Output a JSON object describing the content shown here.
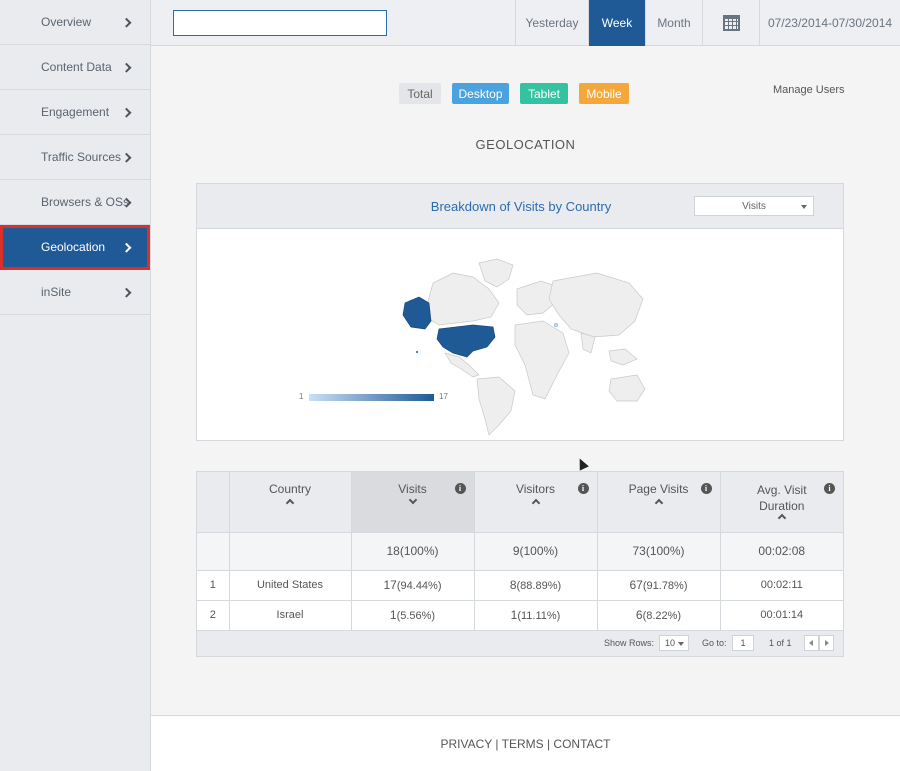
{
  "sidebar": {
    "items": [
      {
        "label": "Overview"
      },
      {
        "label": "Content Data"
      },
      {
        "label": "Engagement"
      },
      {
        "label": "Traffic Sources"
      },
      {
        "label": "Browsers & OSs"
      },
      {
        "label": "Geolocation",
        "active": true
      },
      {
        "label": "inSite"
      }
    ]
  },
  "topbar": {
    "search_value": "",
    "periods": [
      {
        "label": "Yesterday"
      },
      {
        "label": "Week",
        "active": true
      },
      {
        "label": "Month"
      }
    ],
    "calendar_icon": "calendar-icon",
    "date_range": "07/23/2014-07/30/2014"
  },
  "filters": {
    "total": "Total",
    "desktop": "Desktop",
    "tablet": "Tablet",
    "mobile": "Mobile"
  },
  "manage_users": "Manage Users",
  "section_title": "GEOLOCATION",
  "map": {
    "title": "Breakdown of Visits by Country",
    "metric": "Visits",
    "legend_min": "1",
    "legend_max": "17",
    "highlighted": [
      "United States",
      "Israel"
    ]
  },
  "table": {
    "headers": {
      "country": "Country",
      "visits": "Visits",
      "visitors": "Visitors",
      "page_visits": "Page Visits",
      "avg_duration": "Avg. Visit Duration"
    },
    "totals": {
      "visits": "18(100%)",
      "visitors": "9(100%)",
      "page_visits": "73(100%)",
      "avg_duration": "00:02:08"
    },
    "rows": [
      {
        "index": "1",
        "country": "United States",
        "visits": "17",
        "visits_pct": "(94.44%)",
        "visitors": "8",
        "visitors_pct": "(88.89%)",
        "page_visits": "67",
        "page_visits_pct": "(91.78%)",
        "avg_duration": "00:02:11"
      },
      {
        "index": "2",
        "country": "Israel",
        "visits": "1",
        "visits_pct": "(5.56%)",
        "visitors": "1",
        "visitors_pct": "(11.11%)",
        "page_visits": "6",
        "page_visits_pct": "(8.22%)",
        "avg_duration": "00:01:14"
      }
    ],
    "footer": {
      "show_rows_label": "Show Rows:",
      "show_rows_value": "10",
      "goto_label": "Go to:",
      "goto_value": "1",
      "page_info": "1 of 1"
    }
  },
  "page_footer": "PRIVACY | TERMS | CONTACT",
  "colors": {
    "accent": "#1f5a96",
    "active_outline": "#d9302a",
    "desktop": "#4aa3df",
    "tablet": "#35c2a0",
    "mobile": "#f4a73a"
  }
}
